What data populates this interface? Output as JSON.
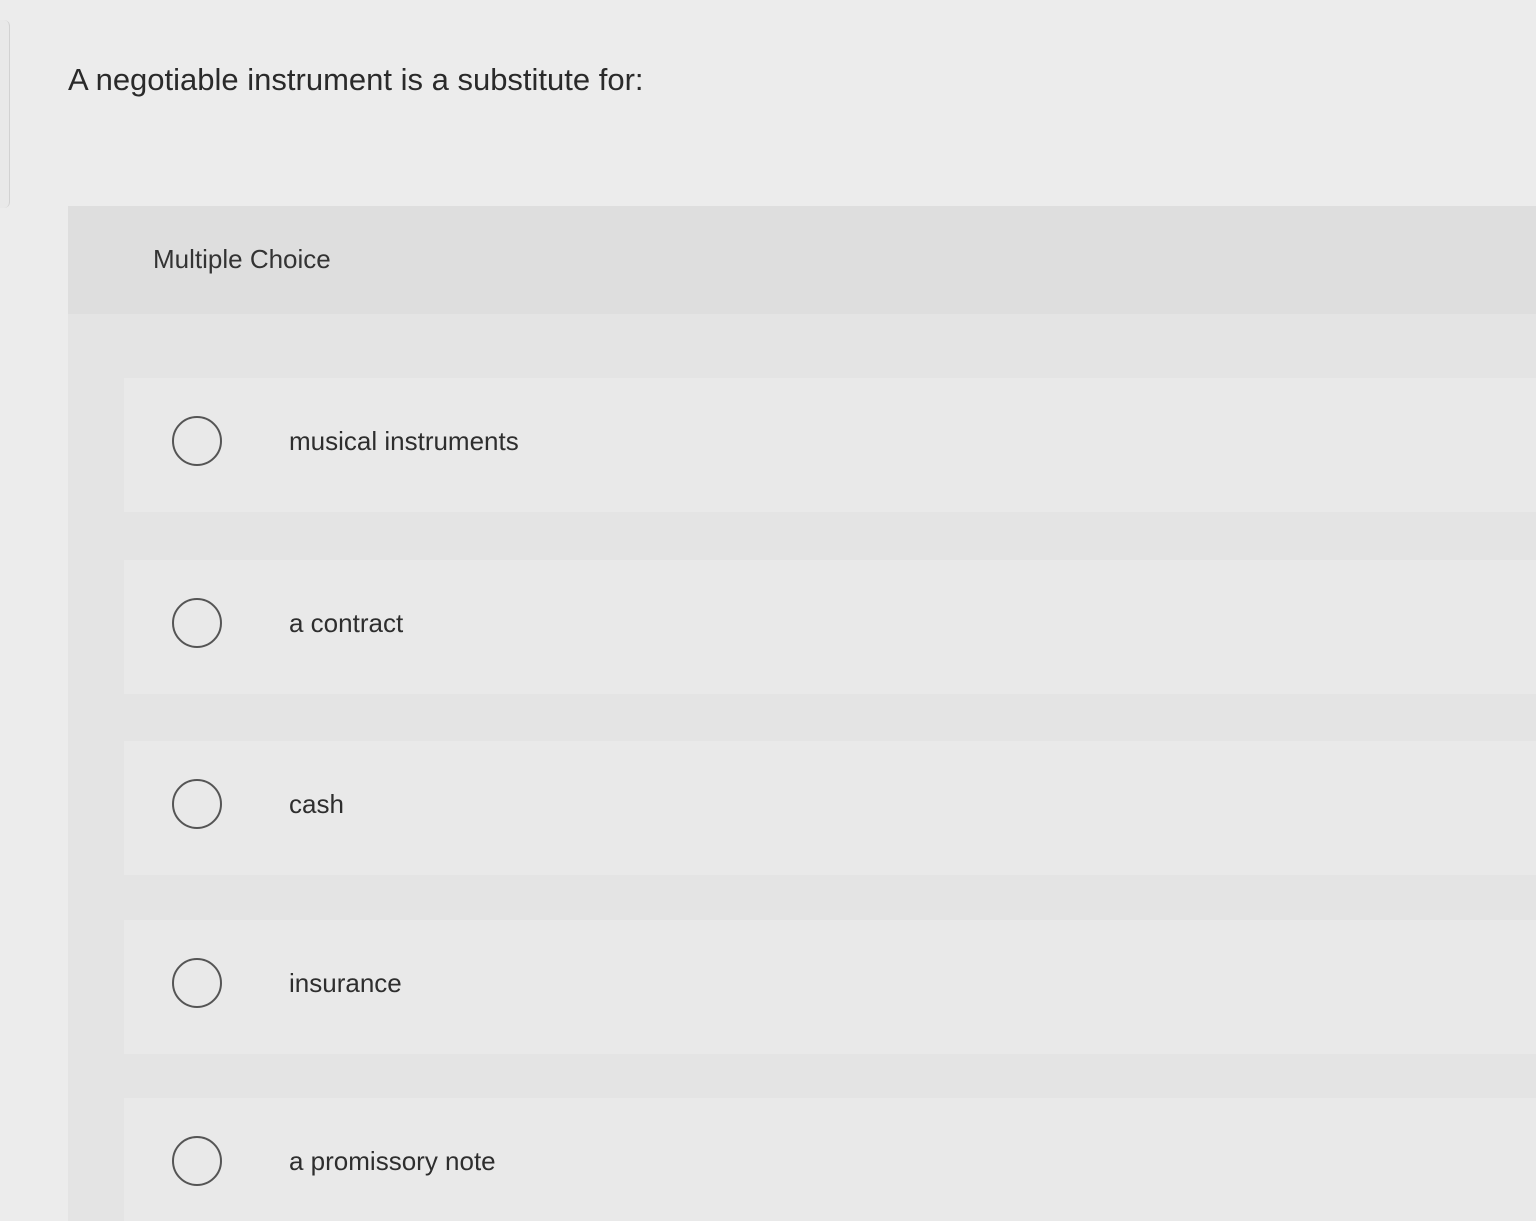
{
  "question": {
    "text": "A negotiable instrument is a substitute for:"
  },
  "card": {
    "label": "Multiple Choice",
    "options": [
      {
        "label": "musical instruments",
        "selected": false
      },
      {
        "label": "a contract",
        "selected": false
      },
      {
        "label": "cash",
        "selected": false
      },
      {
        "label": "insurance",
        "selected": false
      },
      {
        "label": "a promissory note",
        "selected": false
      }
    ]
  },
  "colors": {
    "page_background": "#ececec",
    "card_background": "#e4e4e4",
    "option_background": "#e9e9e9",
    "radio_border": "#555555",
    "text": "#2b2b2b"
  },
  "icons": {
    "radio": "radio-unchecked-icon"
  }
}
